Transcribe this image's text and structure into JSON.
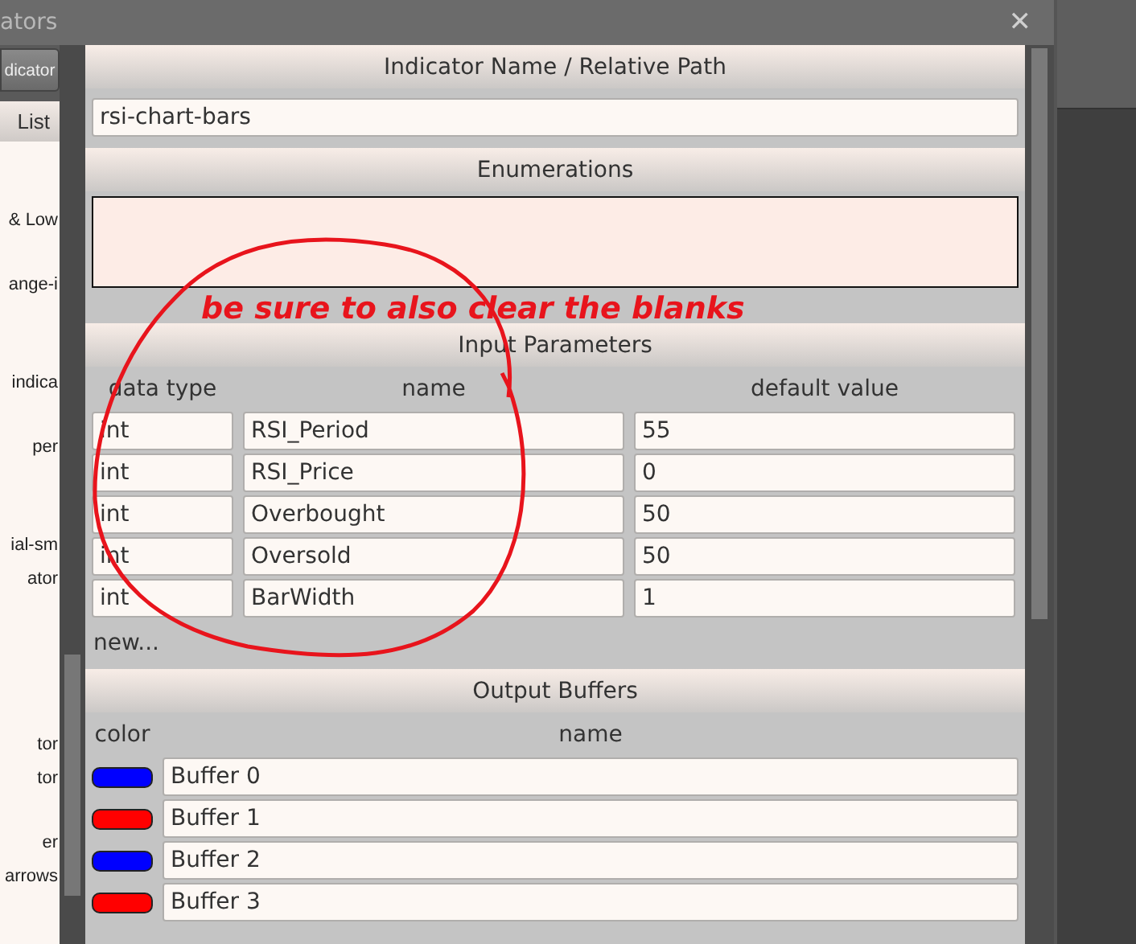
{
  "window": {
    "title": "ators",
    "close": "✕"
  },
  "left_panel": {
    "button": "dicator",
    "header": "List",
    "items": [
      {
        "label": "& Low"
      },
      {
        "label": "ange-i"
      },
      {
        "label": "indica"
      },
      {
        "label": "per"
      },
      {
        "label": "ial-sm"
      },
      {
        "label": "ator"
      },
      {
        "label": "tor"
      },
      {
        "label": "tor"
      },
      {
        "label": "er"
      },
      {
        "label": "arrows"
      }
    ]
  },
  "name_section": {
    "header": "Indicator Name / Relative Path",
    "value": "rsi-chart-bars"
  },
  "enumerations": {
    "header": "Enumerations"
  },
  "input_parameters": {
    "header": "Input Parameters",
    "columns": [
      "data type",
      "name",
      "default value"
    ],
    "rows": [
      [
        "int",
        "RSI_Period",
        "55"
      ],
      [
        "int",
        "RSI_Price",
        "0"
      ],
      [
        "int",
        "Overbought",
        "50"
      ],
      [
        "int",
        "Oversold",
        "50"
      ],
      [
        "int",
        "BarWidth",
        "1"
      ]
    ],
    "new_link": "new..."
  },
  "output_buffers": {
    "header": "Output Buffers",
    "columns": [
      "color",
      "name"
    ],
    "rows": [
      {
        "color": "#0000ff",
        "name": "Buffer 0"
      },
      {
        "color": "#ff0000",
        "name": "Buffer 1"
      },
      {
        "color": "#0000ff",
        "name": "Buffer 2"
      },
      {
        "color": "#ff0000",
        "name": "Buffer 3"
      }
    ]
  },
  "annotation": {
    "text": "be sure to also clear the blanks"
  }
}
